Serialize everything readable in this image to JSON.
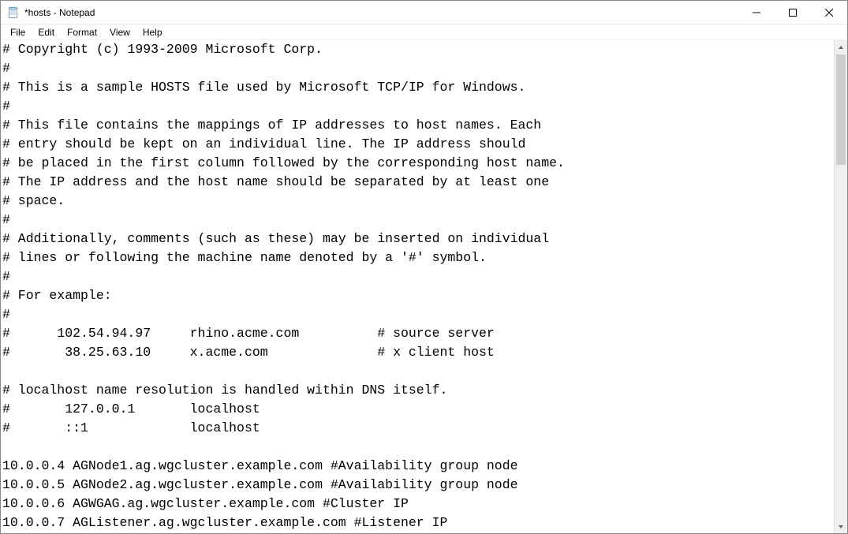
{
  "window": {
    "title": "*hosts - Notepad"
  },
  "menu": {
    "file": "File",
    "edit": "Edit",
    "format": "Format",
    "view": "View",
    "help": "Help"
  },
  "content": "# Copyright (c) 1993-2009 Microsoft Corp.\n#\n# This is a sample HOSTS file used by Microsoft TCP/IP for Windows.\n#\n# This file contains the mappings of IP addresses to host names. Each\n# entry should be kept on an individual line. The IP address should\n# be placed in the first column followed by the corresponding host name.\n# The IP address and the host name should be separated by at least one\n# space.\n#\n# Additionally, comments (such as these) may be inserted on individual\n# lines or following the machine name denoted by a '#' symbol.\n#\n# For example:\n#\n#      102.54.94.97     rhino.acme.com          # source server\n#       38.25.63.10     x.acme.com              # x client host\n\n# localhost name resolution is handled within DNS itself.\n#       127.0.0.1       localhost\n#       ::1             localhost\n\n10.0.0.4 AGNode1.ag.wgcluster.example.com #Availability group node\n10.0.0.5 AGNode2.ag.wgcluster.example.com #Availability group node\n10.0.0.6 AGWGAG.ag.wgcluster.example.com #Cluster IP\n10.0.0.7 AGListener.ag.wgcluster.example.com #Listener IP"
}
